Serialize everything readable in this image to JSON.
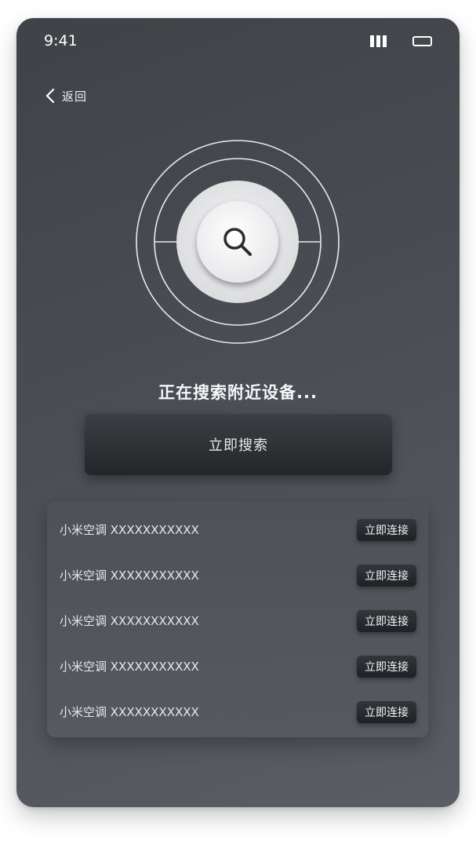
{
  "status_bar": {
    "time": "9:41",
    "signal_icon": "signal-bars-icon",
    "battery_icon": "battery-icon"
  },
  "nav": {
    "back_label": "返回",
    "back_icon": "chevron-left-icon"
  },
  "radar": {
    "center_icon": "search-icon"
  },
  "searching_text": "正在搜索附近设备...",
  "search_button_label": "立即搜索",
  "devices": [
    {
      "name": "小米空调 XXXXXXXXXXX",
      "action": "立即连接"
    },
    {
      "name": "小米空调 XXXXXXXXXXX",
      "action": "立即连接"
    },
    {
      "name": "小米空调 XXXXXXXXXXX",
      "action": "立即连接"
    },
    {
      "name": "小米空调 XXXXXXXXXXX",
      "action": "立即连接"
    },
    {
      "name": "小米空调 XXXXXXXXXXX",
      "action": "立即连接"
    }
  ],
  "colors": {
    "background_top": "#3f4247",
    "background_bottom": "#5a5e64",
    "button_dark": "#232629",
    "text_light": "#f2f3f5"
  }
}
